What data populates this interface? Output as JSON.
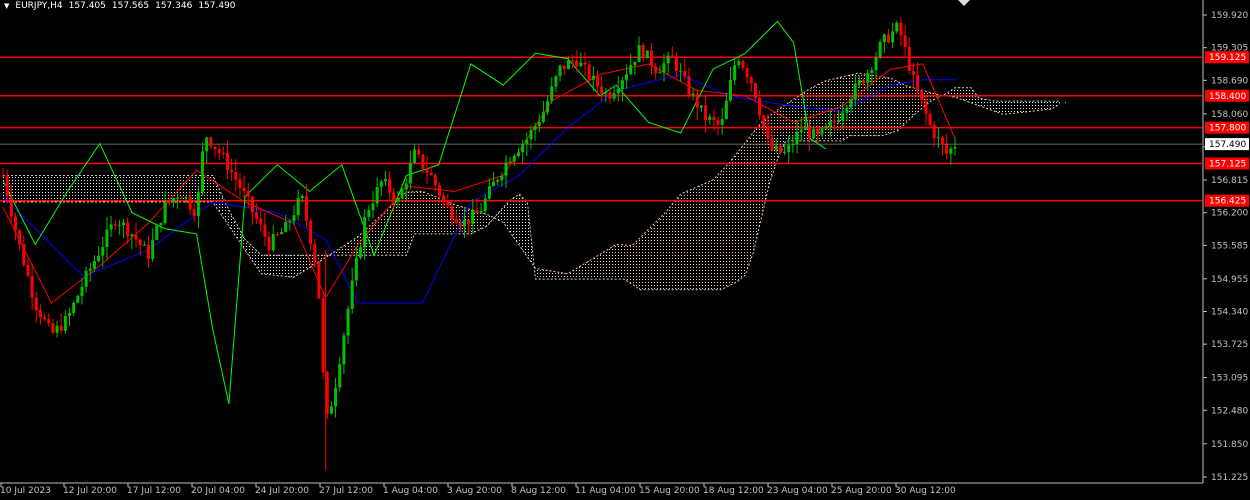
{
  "header": {
    "symbol": "EURJPY,H4",
    "open": "157.405",
    "high": "157.565",
    "low": "157.346",
    "close": "157.490"
  },
  "colors": {
    "background": "#000000",
    "axis": "#c0c0c0",
    "bull_candle": "#00c000",
    "bear_candle": "#ff0000",
    "tenkan": "#ff0000",
    "kijun": "#0000ff",
    "chikou": "#00ff00",
    "cloud_up": "#f5c8a8",
    "cloud_down": "#e0e0e0",
    "level_line": "#ff0000",
    "level_label_bg": "#ff0000",
    "price_label_bg": "#ffffff"
  },
  "chart_data": {
    "type": "candlestick",
    "symbol": "EURJPY",
    "timeframe": "H4",
    "y_range": [
      151.225,
      160.0
    ],
    "y_ticks": [
      "159.920",
      "159.305",
      "158.690",
      "158.060",
      "157.440",
      "156.815",
      "156.200",
      "155.585",
      "154.955",
      "154.340",
      "153.725",
      "153.095",
      "152.480",
      "151.850",
      "151.225"
    ],
    "x_ticks": [
      "10 Jul 2023",
      "12 Jul 20:00",
      "17 Jul 12:00",
      "20 Jul 04:00",
      "24 Jul 20:00",
      "27 Jul 12:00",
      "1 Aug 04:00",
      "3 Aug 20:00",
      "8 Aug 12:00",
      "11 Aug 04:00",
      "15 Aug 20:00",
      "18 Aug 12:00",
      "23 Aug 04:00",
      "25 Aug 20:00",
      "30 Aug 12:00"
    ],
    "levels": [
      {
        "value": 159.125,
        "label": "159.125"
      },
      {
        "value": 158.4,
        "label": "158.400"
      },
      {
        "value": 157.8,
        "label": "157.800"
      },
      {
        "value": 157.125,
        "label": "157.125"
      },
      {
        "value": 156.425,
        "label": "156.425"
      }
    ],
    "current_price": {
      "value": 157.49,
      "label": "157.490"
    },
    "close_path": [
      {
        "t": 0,
        "p": 156.9
      },
      {
        "t": 2,
        "p": 155.6
      },
      {
        "t": 4,
        "p": 154.5
      },
      {
        "t": 6,
        "p": 153.9
      },
      {
        "t": 8,
        "p": 154.2
      },
      {
        "t": 10,
        "p": 154.9
      },
      {
        "t": 12,
        "p": 155.5
      },
      {
        "t": 14,
        "p": 156.1
      },
      {
        "t": 16,
        "p": 155.8
      },
      {
        "t": 18,
        "p": 155.4
      },
      {
        "t": 20,
        "p": 156.3
      },
      {
        "t": 22,
        "p": 156.6
      },
      {
        "t": 24,
        "p": 156.2
      },
      {
        "t": 25,
        "p": 157.7
      },
      {
        "t": 27,
        "p": 157.3
      },
      {
        "t": 29,
        "p": 156.8
      },
      {
        "t": 31,
        "p": 156.2
      },
      {
        "t": 33,
        "p": 155.6
      },
      {
        "t": 35,
        "p": 155.9
      },
      {
        "t": 37,
        "p": 156.5
      },
      {
        "t": 39,
        "p": 155.1
      },
      {
        "t": 40,
        "p": 152.2
      },
      {
        "t": 41,
        "p": 152.8
      },
      {
        "t": 43,
        "p": 154.6
      },
      {
        "t": 45,
        "p": 156.2
      },
      {
        "t": 47,
        "p": 156.8
      },
      {
        "t": 49,
        "p": 156.4
      },
      {
        "t": 51,
        "p": 157.3
      },
      {
        "t": 53,
        "p": 156.9
      },
      {
        "t": 55,
        "p": 156.3
      },
      {
        "t": 57,
        "p": 156.0
      },
      {
        "t": 59,
        "p": 156.2
      },
      {
        "t": 61,
        "p": 156.8
      },
      {
        "t": 63,
        "p": 157.3
      },
      {
        "t": 65,
        "p": 157.6
      },
      {
        "t": 67,
        "p": 158.1
      },
      {
        "t": 69,
        "p": 158.9
      },
      {
        "t": 71,
        "p": 159.1
      },
      {
        "t": 73,
        "p": 158.7
      },
      {
        "t": 75,
        "p": 158.4
      },
      {
        "t": 77,
        "p": 158.8
      },
      {
        "t": 79,
        "p": 159.3
      },
      {
        "t": 81,
        "p": 158.9
      },
      {
        "t": 83,
        "p": 159.1
      },
      {
        "t": 85,
        "p": 158.5
      },
      {
        "t": 87,
        "p": 158.0
      },
      {
        "t": 89,
        "p": 157.8
      },
      {
        "t": 91,
        "p": 159.2
      },
      {
        "t": 93,
        "p": 158.6
      },
      {
        "t": 95,
        "p": 157.4
      },
      {
        "t": 97,
        "p": 157.3
      },
      {
        "t": 99,
        "p": 157.8
      },
      {
        "t": 101,
        "p": 157.6
      },
      {
        "t": 103,
        "p": 157.9
      },
      {
        "t": 105,
        "p": 158.4
      },
      {
        "t": 107,
        "p": 158.8
      },
      {
        "t": 109,
        "p": 159.4
      },
      {
        "t": 111,
        "p": 159.7
      },
      {
        "t": 113,
        "p": 158.6
      },
      {
        "t": 115,
        "p": 157.8
      },
      {
        "t": 117,
        "p": 157.3
      },
      {
        "t": 118,
        "p": 157.49
      }
    ],
    "tenkan": [
      [
        0,
        156.3
      ],
      [
        6,
        154.5
      ],
      [
        12,
        155.2
      ],
      [
        18,
        156.0
      ],
      [
        24,
        157.0
      ],
      [
        30,
        156.4
      ],
      [
        36,
        156.0
      ],
      [
        40,
        154.6
      ],
      [
        44,
        155.6
      ],
      [
        50,
        156.7
      ],
      [
        56,
        156.6
      ],
      [
        62,
        156.9
      ],
      [
        68,
        158.3
      ],
      [
        74,
        158.8
      ],
      [
        80,
        159.0
      ],
      [
        86,
        158.5
      ],
      [
        92,
        158.4
      ],
      [
        98,
        157.9
      ],
      [
        104,
        158.2
      ],
      [
        110,
        158.9
      ],
      [
        114,
        159.0
      ],
      [
        118,
        157.6
      ]
    ],
    "kijun": [
      [
        0,
        156.5
      ],
      [
        10,
        155.0
      ],
      [
        18,
        155.5
      ],
      [
        26,
        156.4
      ],
      [
        34,
        156.2
      ],
      [
        40,
        155.7
      ],
      [
        44,
        154.5
      ],
      [
        52,
        154.5
      ],
      [
        58,
        156.4
      ],
      [
        64,
        156.9
      ],
      [
        70,
        157.8
      ],
      [
        76,
        158.5
      ],
      [
        84,
        158.8
      ],
      [
        90,
        158.4
      ],
      [
        98,
        158.2
      ],
      [
        104,
        158.1
      ],
      [
        110,
        158.6
      ],
      [
        114,
        158.7
      ],
      [
        118,
        158.7
      ]
    ],
    "chikou": [
      [
        0,
        156.8
      ],
      [
        4,
        155.6
      ],
      [
        8,
        156.6
      ],
      [
        12,
        157.5
      ],
      [
        16,
        156.2
      ],
      [
        20,
        155.9
      ],
      [
        24,
        155.8
      ],
      [
        26,
        154.0
      ],
      [
        28,
        152.6
      ],
      [
        30,
        156.5
      ],
      [
        34,
        157.1
      ],
      [
        38,
        156.6
      ],
      [
        42,
        157.1
      ],
      [
        46,
        155.4
      ],
      [
        50,
        156.9
      ],
      [
        54,
        157.1
      ],
      [
        58,
        159.0
      ],
      [
        62,
        158.6
      ],
      [
        66,
        159.2
      ],
      [
        70,
        159.1
      ],
      [
        74,
        158.4
      ],
      [
        76,
        158.6
      ],
      [
        80,
        157.9
      ],
      [
        84,
        157.7
      ],
      [
        88,
        158.9
      ],
      [
        92,
        159.2
      ],
      [
        96,
        159.8
      ],
      [
        98,
        159.4
      ],
      [
        100,
        157.6
      ],
      [
        102,
        157.4
      ]
    ]
  }
}
